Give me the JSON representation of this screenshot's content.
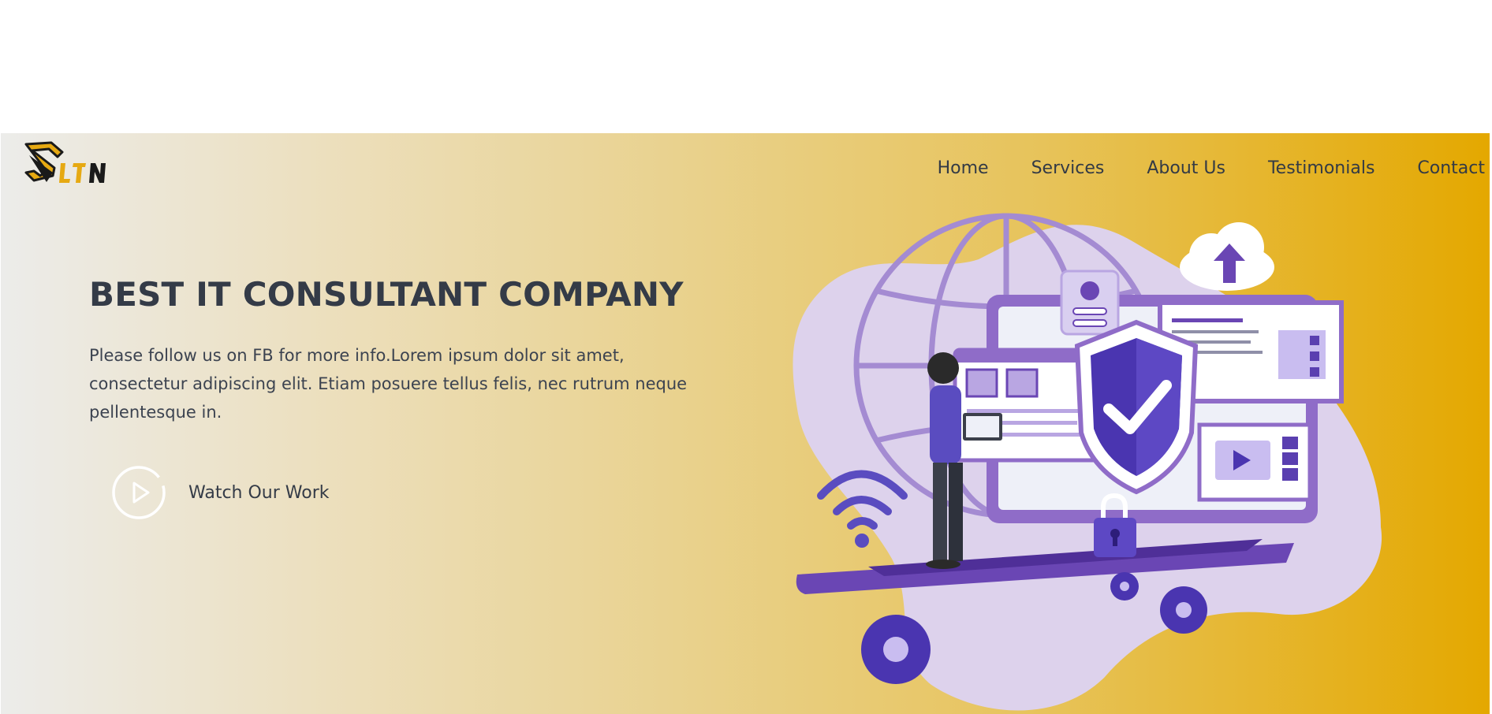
{
  "brand": {
    "logo_text": "LTN",
    "colors": {
      "primary": "#e4a800",
      "dark": "#1a1a1a"
    }
  },
  "nav": {
    "items": [
      {
        "label": "Home"
      },
      {
        "label": "Services"
      },
      {
        "label": "About Us"
      },
      {
        "label": "Testimonials"
      },
      {
        "label": "Contact"
      }
    ]
  },
  "hero": {
    "title": "BEST IT CONSULTANT COMPANY",
    "description": "Please follow us on FB for more info.Lorem ipsum dolor sit amet, consectetur adipiscing elit. Etiam posuere tellus felis, nec rutrum neque pellentesque in.",
    "cta_label": "Watch Our Work",
    "cta_icon": "play-icon",
    "illustration": "security-laptop-illustration",
    "colors": {
      "gradient_start": "#ececea",
      "gradient_end": "#e4a800",
      "text": "#343b47",
      "illustration_purple": "#6b4fbb",
      "illustration_lilac": "#ddd2ec"
    }
  }
}
